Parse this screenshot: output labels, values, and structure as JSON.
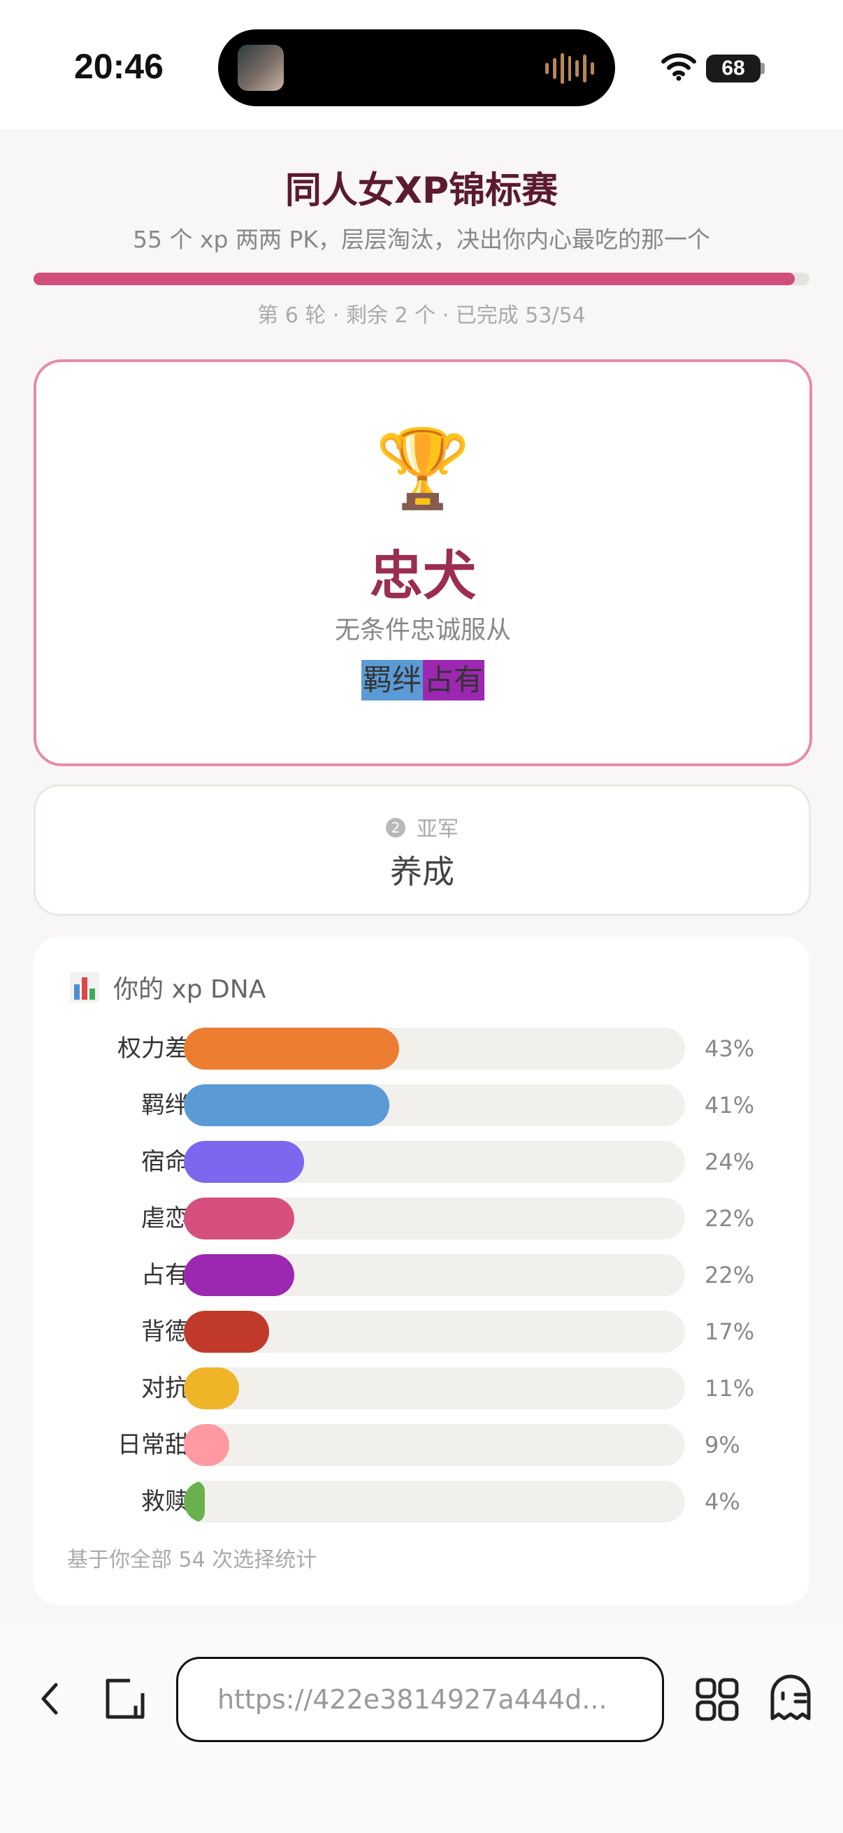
{
  "status_bar": {
    "time": "20:46",
    "battery": "68"
  },
  "header": {
    "title": "同人女XP锦标赛",
    "subtitle": "55 个 xp 两两 PK，层层淘汰，决出你内心最吃的那一个",
    "progress": 0.981,
    "round_info": "第 6 轮 · 剩余 2 个 · 已完成 53/54"
  },
  "champion": {
    "icon": "trophy-icon",
    "name": "忠犬",
    "description": "无条件忠诚服从",
    "tags": [
      {
        "label": "羁绊",
        "color": "#5b9bd5"
      },
      {
        "label": "占有",
        "color": "#9c27b0"
      }
    ]
  },
  "runner_up": {
    "icon": "silver-medal-icon",
    "medal_number": "2",
    "label": "亚军",
    "name": "养成"
  },
  "dna": {
    "icon": "bar-chart-icon",
    "title": "你的 xp DNA",
    "rows": [
      {
        "label": "权力差",
        "pct_text": "43%",
        "value": 43,
        "color": "#ed7d31"
      },
      {
        "label": "羁绊",
        "pct_text": "41%",
        "value": 41,
        "color": "#5b9bd5"
      },
      {
        "label": "宿命",
        "pct_text": "24%",
        "value": 24,
        "color": "#7b68ee"
      },
      {
        "label": "虐恋",
        "pct_text": "22%",
        "value": 22,
        "color": "#d64f7e"
      },
      {
        "label": "占有",
        "pct_text": "22%",
        "value": 22,
        "color": "#9c27b0"
      },
      {
        "label": "背德",
        "pct_text": "17%",
        "value": 17,
        "color": "#c0392b"
      },
      {
        "label": "对抗",
        "pct_text": "11%",
        "value": 11,
        "color": "#f0b429"
      },
      {
        "label": "日常甜",
        "pct_text": "9%",
        "value": 9,
        "color": "#ff9aa2"
      },
      {
        "label": "救赎",
        "pct_text": "4%",
        "value": 4,
        "color": "#6ab04c"
      }
    ],
    "footer": "基于你全部 54 次选择统计"
  },
  "browser": {
    "url": "https://422e3814927a444d...",
    "icons": [
      "back-icon",
      "tabs-icon",
      "apps-icon",
      "ghost-icon"
    ]
  }
}
